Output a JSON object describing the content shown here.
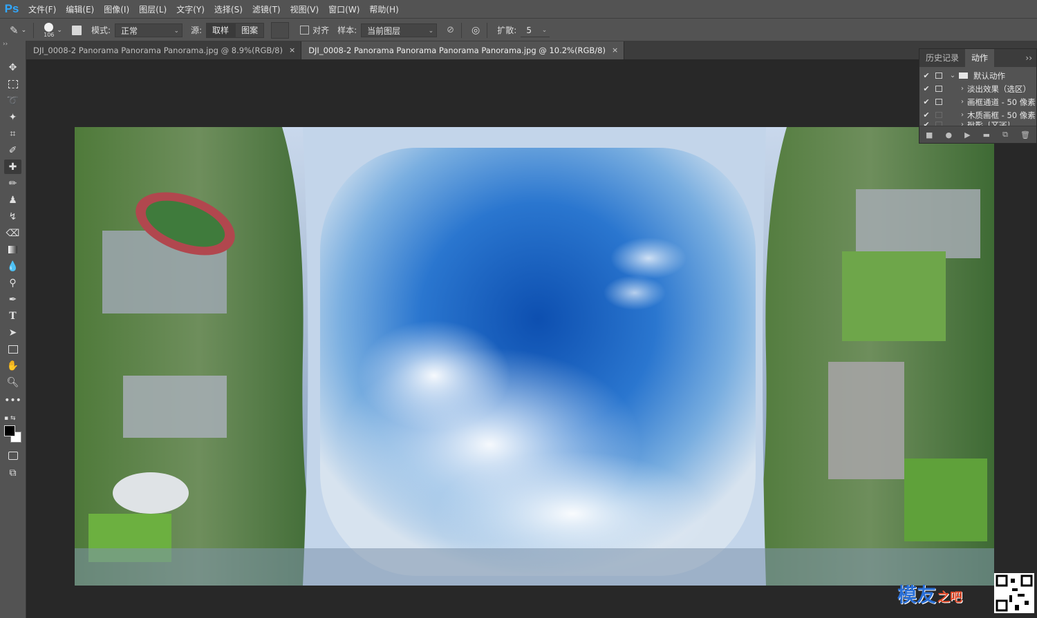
{
  "menubar": {
    "logo": "Ps",
    "items": [
      "文件(F)",
      "编辑(E)",
      "图像(I)",
      "图层(L)",
      "文字(Y)",
      "选择(S)",
      "滤镜(T)",
      "视图(V)",
      "窗口(W)",
      "帮助(H)"
    ]
  },
  "options": {
    "brush_size": "106",
    "mode_label": "模式:",
    "mode_value": "正常",
    "source_label": "源:",
    "source_sample": "取样",
    "source_pattern": "图案",
    "align_label": "对齐",
    "sample_label": "样本:",
    "sample_value": "当前图层",
    "diffusion_label": "扩散:",
    "diffusion_value": "5"
  },
  "tabs": [
    {
      "label": "DJI_0008-2 Panorama Panorama Panorama.jpg @ 8.9%(RGB/8)",
      "close": "×"
    },
    {
      "label": "DJI_0008-2 Panorama Panorama Panorama Panorama.jpg @ 10.2%(RGB/8)",
      "close": "×"
    }
  ],
  "panel": {
    "tab_history": "历史记录",
    "tab_actions": "动作",
    "collapse": "››",
    "actions": [
      {
        "label": "默认动作",
        "type": "folder"
      },
      {
        "label": "淡出效果（选区）",
        "type": "action"
      },
      {
        "label": "画框通道 - 50 像素",
        "type": "action"
      },
      {
        "label": "木质画框 - 50 像素",
        "type": "action"
      },
      {
        "label": "投影（文字）",
        "type": "action"
      }
    ]
  },
  "watermark": {
    "text": "模友",
    "sub": "之吧"
  },
  "colors": {
    "accent": "#31a8ff",
    "ui_bg": "#535353",
    "canvas_bg": "#282828"
  }
}
